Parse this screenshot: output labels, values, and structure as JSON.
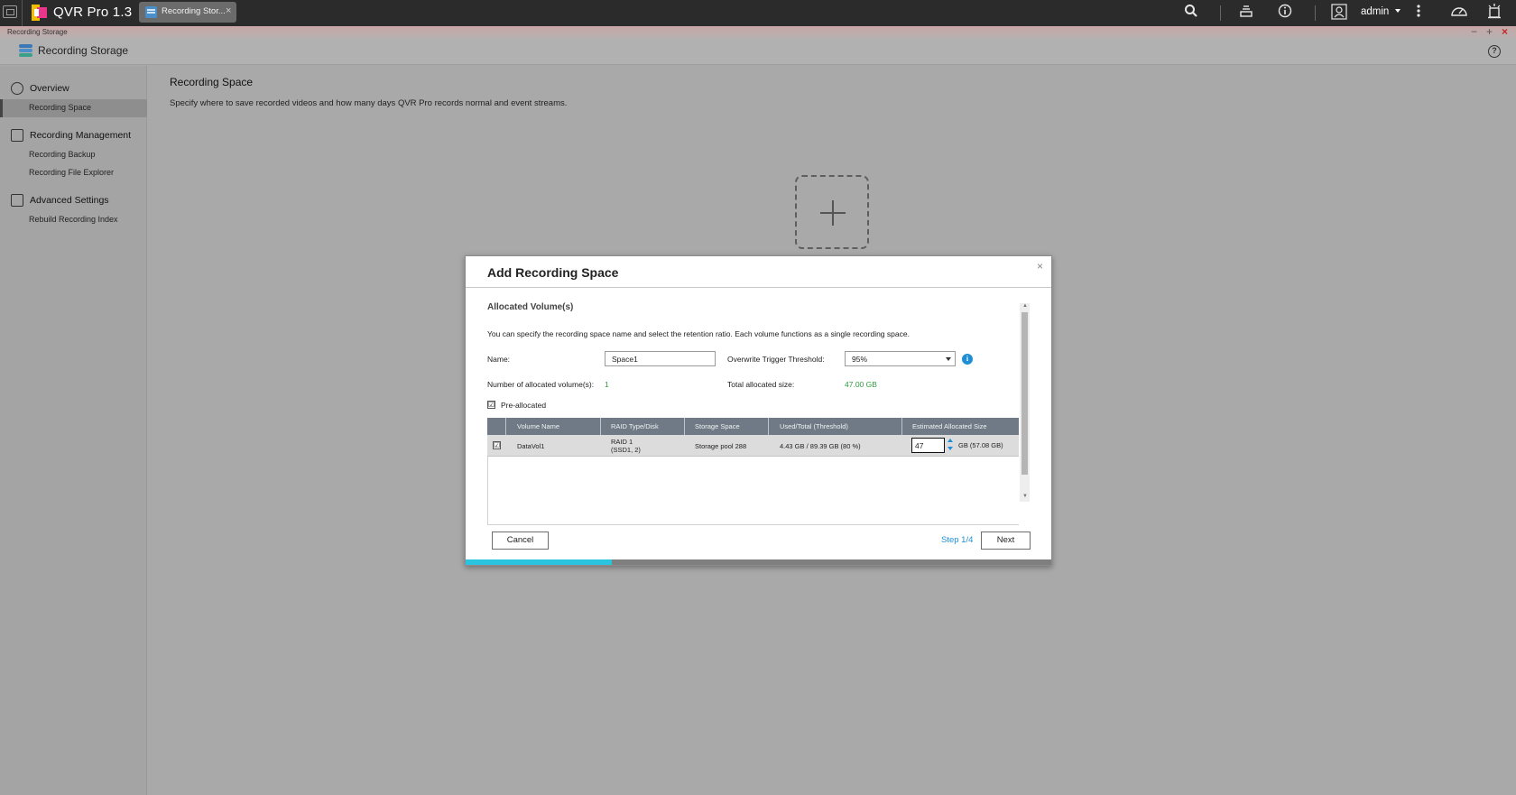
{
  "topbar": {
    "app_name": "QVR Pro 1.3",
    "task_tab_label": "Recording Stor...",
    "task_tab_close": "×",
    "user": "admin"
  },
  "window": {
    "title": "Recording Storage",
    "minimize": "−",
    "maximize": "+",
    "close": "×"
  },
  "header": {
    "title": "Recording Storage",
    "help": "?"
  },
  "sidebar": {
    "groups": [
      {
        "label": "Overview",
        "icon": "gauge-icon",
        "items": [
          "Recording Space"
        ]
      },
      {
        "label": "Recording Management",
        "icon": "folder-icon",
        "items": [
          "Recording Backup",
          "Recording File Explorer"
        ]
      },
      {
        "label": "Advanced Settings",
        "icon": "settings-list-icon",
        "items": [
          "Rebuild Recording Index"
        ]
      }
    ],
    "active_item": "Recording Space"
  },
  "main": {
    "title": "Recording Space",
    "description": "Specify where to save recorded videos and how many days QVR Pro records normal and event streams."
  },
  "dialog": {
    "title": "Add Recording Space",
    "close": "×",
    "section_title": "Allocated Volume(s)",
    "description": "You can specify the recording space name and select the retention ratio. Each volume functions as a single recording space.",
    "name_label": "Name:",
    "name_value": "Space1",
    "threshold_label": "Overwrite Trigger Threshold:",
    "threshold_value": "95%",
    "info": "i",
    "allocated_count_label": "Number of allocated volume(s):",
    "allocated_count_value": "1",
    "total_size_label": "Total allocated size:",
    "total_size_value": "47.00 GB",
    "preallocated_label": "Pre-allocated",
    "preallocated_checked": "☑",
    "table": {
      "headers": [
        "Volume Name",
        "RAID Type/Disk",
        "Storage Space",
        "Used/Total (Threshold)",
        "Estimated Allocated Size"
      ],
      "rows": [
        {
          "checked": "☑",
          "volume_name": "DataVol1",
          "raid_type": "RAID 1",
          "raid_disks": "(SSD1, 2)",
          "storage_space": "Storage pool 288",
          "used_total": "4.43 GB / 89.39 GB (80 %)",
          "size_value": "47",
          "size_unit": "GB (57.08 GB)"
        }
      ]
    },
    "cancel_label": "Cancel",
    "step_label": "Step 1/4",
    "next_label": "Next",
    "progress": 0.25
  },
  "colors": {
    "accent_blue": "#1e8fd6",
    "progress_fill": "#2bc4de",
    "green_value": "#2c9a3c",
    "topbar_bg": "#2b2b2b"
  }
}
